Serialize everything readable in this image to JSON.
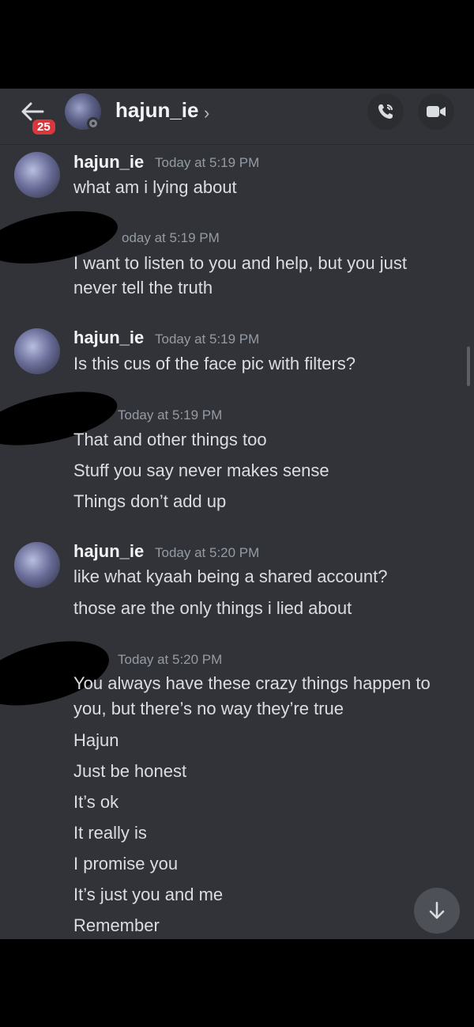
{
  "header": {
    "unread_count": "25",
    "username": "hajun_ie",
    "chevron": "›",
    "icons": {
      "back": "arrow-left-icon",
      "call": "phone-icon",
      "video": "video-camera-icon"
    }
  },
  "messages": [
    {
      "username": "hajun_ie",
      "timestamp": "Today at 5:19 PM",
      "lines": [
        "what am i lying about"
      ]
    },
    {
      "username": "",
      "timestamp": "Today at 5:19 PM",
      "timestamp_visible": "oday at 5:19 PM",
      "lines": [
        "I want to listen to you and help, but you just",
        "never tell the truth"
      ]
    },
    {
      "username": "hajun_ie",
      "timestamp": "Today at 5:19 PM",
      "lines": [
        "Is this cus of the face pic with filters?"
      ]
    },
    {
      "username": "",
      "timestamp": "Today at 5:19 PM",
      "lines": [
        "That and other things too",
        "Stuff you say never makes sense",
        "Things don’t add up"
      ]
    },
    {
      "username": "hajun_ie",
      "timestamp": "Today at 5:20 PM",
      "lines": [
        "like what kyaah being a shared account?",
        "those are the only things i lied about"
      ]
    },
    {
      "username": "",
      "timestamp": "Today at 5:20 PM",
      "lines": [
        "You always have these crazy things happen to",
        "you, but there’s no way they’re true",
        "Hajun",
        "Just be honest",
        "It’s ok",
        "It really is",
        "I promise you",
        "It’s just you and me",
        "Remember"
      ]
    }
  ],
  "colors": {
    "background": "#313338",
    "text": "#dbdee1",
    "muted": "#949ba4",
    "badge": "#da373c"
  }
}
